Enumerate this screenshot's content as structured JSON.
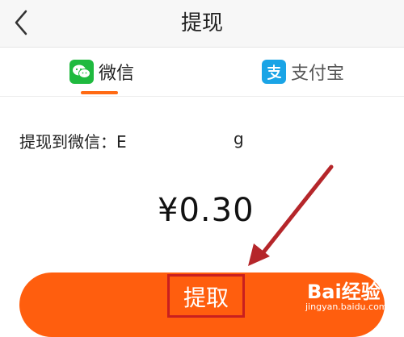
{
  "header": {
    "title": "提现"
  },
  "tabs": [
    {
      "label": "微信"
    },
    {
      "label": "支付宝"
    }
  ],
  "withdraw": {
    "to_label": "提现到微信：E",
    "account_tail": "g",
    "amount": "¥0.30"
  },
  "action": {
    "submit_label": "提取"
  },
  "watermark": {
    "brand": "Bai经验",
    "url": "jingyan.baidu.com"
  },
  "colors": {
    "accent": "#ff5e0e",
    "highlight_box": "#c91f1f",
    "arrow": "#b5262a",
    "wechat": "#1fba3f",
    "alipay": "#1aa4e6"
  }
}
